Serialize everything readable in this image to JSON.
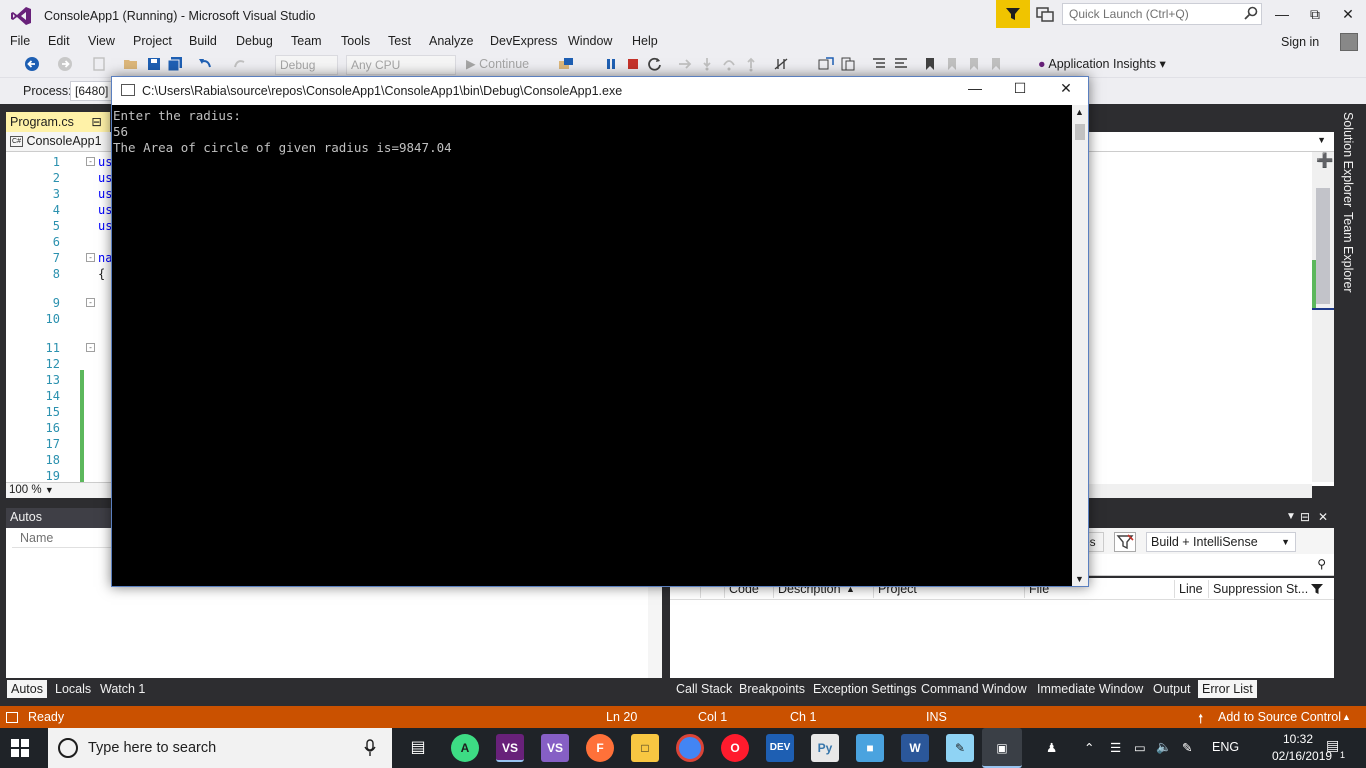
{
  "window": {
    "title": "ConsoleApp1 (Running) - Microsoft Visual Studio",
    "quick_launch_placeholder": "Quick Launch (Ctrl+Q)"
  },
  "menu": [
    "File",
    "Edit",
    "View",
    "Project",
    "Build",
    "Debug",
    "Team",
    "Tools",
    "Test",
    "Analyze",
    "DevExpress",
    "Window",
    "Help"
  ],
  "account": {
    "signin_label": "Sign in"
  },
  "toolbar": {
    "config": "Debug",
    "platform": "Any CPU",
    "continue_label": "Continue",
    "app_insights_label": "Application Insights"
  },
  "debug_location": {
    "process_label": "Process:",
    "process_value": "[6480]"
  },
  "editor": {
    "tab_label": "Program.cs",
    "nav_project": "ConsoleApp1",
    "zoom": "100 %",
    "line_numbers": [
      "1",
      "2",
      "3",
      "4",
      "5",
      "6",
      "7",
      "8",
      "9",
      "10",
      "11",
      "12",
      "13",
      "14",
      "15",
      "16",
      "17",
      "18",
      "19"
    ],
    "code_fragments": [
      "us",
      "us",
      "us",
      "us",
      "us",
      "na",
      "{"
    ]
  },
  "side_tabs": [
    "Solution Explorer",
    "Team Explorer"
  ],
  "autos": {
    "title": "Autos",
    "column_name": "Name",
    "tabs": [
      "Autos",
      "Locals",
      "Watch 1"
    ]
  },
  "error_list": {
    "filter_fragment": "es",
    "build_filter": "Build + IntelliSense",
    "columns": [
      "Code",
      "Description",
      "Project",
      "File",
      "Line",
      "Suppression St..."
    ],
    "tabs": [
      "Call Stack",
      "Breakpoints",
      "Exception Settings",
      "Command Window",
      "Immediate Window",
      "Output",
      "Error List"
    ]
  },
  "status_bar": {
    "state": "Ready",
    "line": "Ln 20",
    "col": "Col 1",
    "ch": "Ch 1",
    "mode": "INS",
    "source_control": "Add to Source Control"
  },
  "console": {
    "title": "C:\\Users\\Rabia\\source\\repos\\ConsoleApp1\\ConsoleApp1\\bin\\Debug\\ConsoleApp1.exe",
    "lines": [
      "Enter the radius:",
      "56",
      "The Area of circle of given radius is=9847.04"
    ]
  },
  "taskbar": {
    "search_placeholder": "Type here to search",
    "language": "ENG",
    "time": "10:32",
    "date": "02/16/2019",
    "notification_count": "1",
    "apps": [
      "task-view",
      "android-studio",
      "visual-studio",
      "visual-studio-2",
      "firefox",
      "file-explorer",
      "chrome",
      "opera",
      "devexpress",
      "python",
      "3d-app",
      "word",
      "notepad",
      "console-app"
    ]
  },
  "colors": {
    "status_bar": "#ca5100",
    "tab_active": "#fff2a8",
    "filter_button": "#f0c400",
    "vs_purple": "#68217a"
  }
}
